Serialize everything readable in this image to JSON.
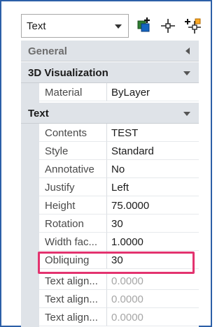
{
  "toolbar": {
    "object_type": "Text",
    "icons": [
      "quick-select-icon",
      "select-objects-icon",
      "toggle-pickadd-icon"
    ]
  },
  "categories": {
    "general": {
      "label": "General",
      "state": "collapsed"
    },
    "visualization": {
      "label": "3D Visualization",
      "state": "expanded",
      "rows": [
        {
          "name": "Material",
          "value": "ByLayer"
        }
      ]
    },
    "text": {
      "label": "Text",
      "state": "expanded",
      "rows": [
        {
          "name": "Contents",
          "value": "TEST"
        },
        {
          "name": "Style",
          "value": "Standard"
        },
        {
          "name": "Annotative",
          "value": "No"
        },
        {
          "name": "Justify",
          "value": "Left"
        },
        {
          "name": "Height",
          "value": "75.0000"
        },
        {
          "name": "Rotation",
          "value": "30"
        },
        {
          "name": "Width fac...",
          "value": "1.0000"
        },
        {
          "name": "Obliquing",
          "value": "30"
        },
        {
          "name": "Text align...",
          "value": "0.0000"
        },
        {
          "name": "Text align...",
          "value": "0.0000"
        },
        {
          "name": "Text align...",
          "value": "0.0000"
        }
      ]
    }
  },
  "highlight": {
    "property": "Obliquing",
    "color": "#e3336f"
  },
  "colors": {
    "border": "#2c5fa8",
    "category_bg": "#dfe3e8",
    "greyed_value": "#a6a6a6"
  }
}
